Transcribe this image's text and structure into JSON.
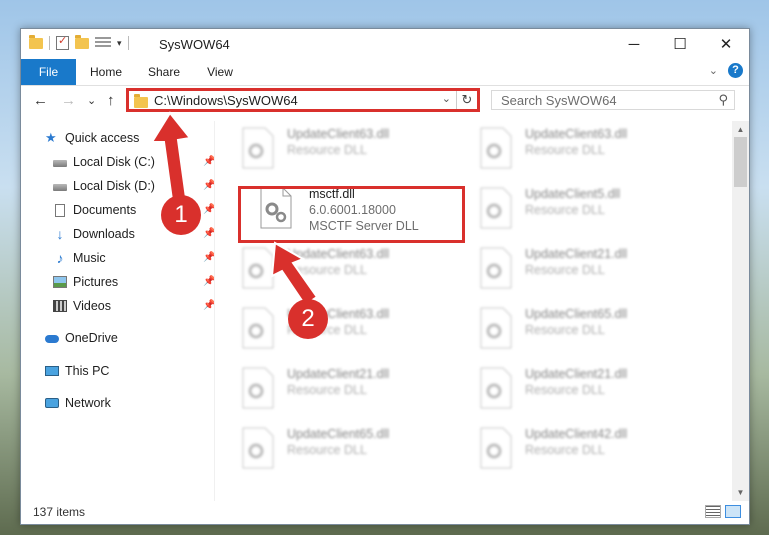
{
  "window": {
    "title": "SysWOW64",
    "caption_buttons": [
      "─",
      "☐",
      "✕"
    ]
  },
  "ribbon": {
    "tabs": [
      "File",
      "Home",
      "Share",
      "View"
    ],
    "help_label": "?"
  },
  "nav": {
    "back_glyph": "←",
    "forward_glyph": "→",
    "recent_glyph": "⌄",
    "up_glyph": "↑",
    "address": "C:\\Windows\\SysWOW64",
    "search_placeholder": "Search SysWOW64"
  },
  "sidebar": {
    "items": [
      {
        "label": "Quick access",
        "icon": "star-icon"
      },
      {
        "label": "Local Disk (C:)",
        "icon": "disk-icon",
        "pinned": true
      },
      {
        "label": "Local Disk (D:)",
        "icon": "disk-icon",
        "pinned": true
      },
      {
        "label": "Documents",
        "icon": "documents-icon",
        "pinned": true
      },
      {
        "label": "Downloads",
        "icon": "download-icon",
        "pinned": true
      },
      {
        "label": "Music",
        "icon": "music-icon",
        "pinned": true
      },
      {
        "label": "Pictures",
        "icon": "pictures-icon",
        "pinned": true
      },
      {
        "label": "Videos",
        "icon": "videos-icon",
        "pinned": true
      },
      {
        "label": "OneDrive",
        "icon": "onedrive-icon"
      },
      {
        "label": "This PC",
        "icon": "computer-icon",
        "selected": true
      },
      {
        "label": "Network",
        "icon": "network-icon"
      }
    ]
  },
  "files": {
    "highlighted": {
      "name": "msctf.dll",
      "version": "6.0.6001.18000",
      "description": "MSCTF Server DLL"
    },
    "left_column": [
      {
        "name": "UpdateClient63.dll",
        "description": "Resource DLL"
      },
      {
        "name": "msctf.dll",
        "description": "MSCTF Server DLL"
      },
      {
        "name": "UpdateClient63.dll",
        "description": "Resource DLL"
      },
      {
        "name": "UpdateClient63.dll",
        "description": "Resource DLL"
      },
      {
        "name": "UpdateClient21.dll",
        "description": "Resource DLL"
      },
      {
        "name": "UpdateClient65.dll",
        "description": "Resource DLL"
      }
    ],
    "right_column": [
      {
        "name": "UpdateClient63.dll",
        "description": "Resource DLL"
      },
      {
        "name": "UpdateClient5.dll",
        "description": "Resource DLL"
      },
      {
        "name": "UpdateClient21.dll",
        "description": "Resource DLL"
      },
      {
        "name": "UpdateClient65.dll",
        "description": "Resource DLL"
      },
      {
        "name": "UpdateClient21.dll",
        "description": "Resource DLL"
      },
      {
        "name": "UpdateClient42.dll",
        "description": "Resource DLL"
      }
    ]
  },
  "status": {
    "item_count": "137 items"
  },
  "callouts": {
    "one": "1",
    "two": "2",
    "color": "#d9302c"
  }
}
